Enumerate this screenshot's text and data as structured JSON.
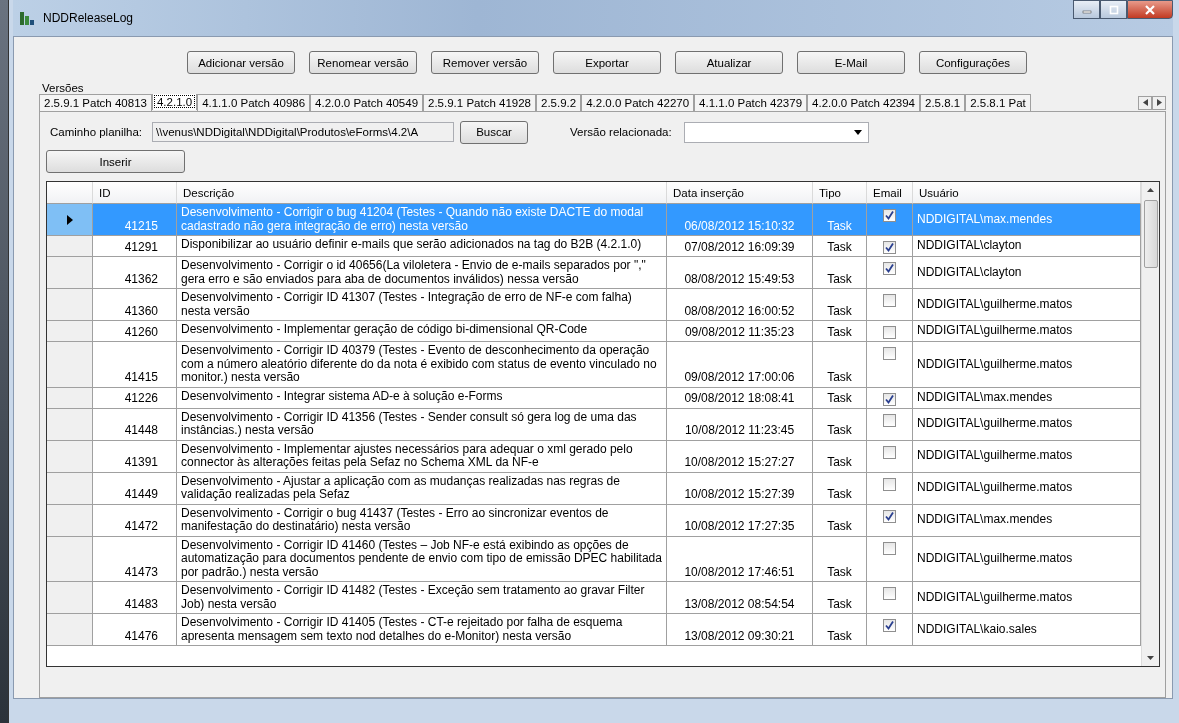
{
  "window": {
    "title": "NDDReleaseLog"
  },
  "toolbar": [
    "Adicionar versão",
    "Renomear versão",
    "Remover versão",
    "Exportar",
    "Atualizar",
    "E-Mail",
    "Configurações"
  ],
  "versions_label": "Versões",
  "tabs": [
    {
      "label": "2.5.9.1 Patch 40813",
      "selected": false
    },
    {
      "label": "4.2.1.0",
      "selected": true
    },
    {
      "label": "4.1.1.0 Patch 40986",
      "selected": false
    },
    {
      "label": "4.2.0.0 Patch 40549",
      "selected": false
    },
    {
      "label": "2.5.9.1 Patch 41928",
      "selected": false
    },
    {
      "label": "2.5.9.2",
      "selected": false
    },
    {
      "label": "4.2.0.0 Patch 42270",
      "selected": false
    },
    {
      "label": "4.1.1.0 Patch 42379",
      "selected": false
    },
    {
      "label": "4.2.0.0 Patch 42394",
      "selected": false
    },
    {
      "label": "2.5.8.1",
      "selected": false
    },
    {
      "label": "2.5.8.1 Pat",
      "selected": false
    }
  ],
  "path": {
    "label": "Caminho planilha:",
    "value": "\\\\venus\\NDDigital\\NDDigital\\Produtos\\eForms\\4.2\\A"
  },
  "browse_button": "Buscar",
  "related": {
    "label": "Versão relacionada:"
  },
  "insert_button": "Inserir",
  "table": {
    "columns": [
      "ID",
      "Descrição",
      "Data inserção",
      "Tipo",
      "Email",
      "Usuário"
    ],
    "rows": [
      {
        "id": "41215",
        "description": "Desenvolvimento - Corrigir o bug 41204 (Testes - Quando não existe DACTE do modal cadastrado não gera integração de erro) nesta versão",
        "date": "06/08/2012 15:10:32",
        "type": "Task",
        "email": true,
        "user": "NDDIGITAL\\max.mendes",
        "selected": true
      },
      {
        "id": "41291",
        "description": "Disponibilizar ao usuário definir e-mails que serão adicionados na tag do B2B (4.2.1.0)",
        "date": "07/08/2012 16:09:39",
        "type": "Task",
        "email": true,
        "user": "NDDIGITAL\\clayton",
        "selected": false
      },
      {
        "id": "41362",
        "description": "Desenvolvimento - Corrigir o id 40656(La viloletera - Envio de e-mails separados por \",\" gera erro e são enviados para aba de documentos inválidos) nessa versão",
        "date": "08/08/2012 15:49:53",
        "type": "Task",
        "email": true,
        "user": "NDDIGITAL\\clayton",
        "selected": false
      },
      {
        "id": "41360",
        "description": "Desenvolvimento - Corrigir ID 41307 (Testes - Integração de erro de NF-e com falha) nesta versão",
        "date": "08/08/2012 16:00:52",
        "type": "Task",
        "email": false,
        "user": "NDDIGITAL\\guilherme.matos",
        "selected": false
      },
      {
        "id": "41260",
        "description": "Desenvolvimento - Implementar geração de código bi-dimensional QR-Code",
        "date": "09/08/2012 11:35:23",
        "type": "Task",
        "email": false,
        "user": "NDDIGITAL\\guilherme.matos",
        "selected": false
      },
      {
        "id": "41415",
        "description": "Desenvolvimento - Corrigir ID 40379 (Testes - Evento de desconhecimento da operação com a número aleatório diferente do da nota é exibido com status de evento vinculado no monitor.) nesta versão",
        "date": "09/08/2012 17:00:06",
        "type": "Task",
        "email": false,
        "user": "NDDIGITAL\\guilherme.matos",
        "selected": false
      },
      {
        "id": "41226",
        "description": "Desenvolvimento - Integrar sistema AD-e à solução e-Forms",
        "date": "09/08/2012 18:08:41",
        "type": "Task",
        "email": true,
        "user": "NDDIGITAL\\max.mendes",
        "selected": false
      },
      {
        "id": "41448",
        "description": "Desenvolvimento - Corrigir ID 41356 (Testes - Sender consult só gera log de uma das instâncias.) nesta versão",
        "date": "10/08/2012 11:23:45",
        "type": "Task",
        "email": false,
        "user": "NDDIGITAL\\guilherme.matos",
        "selected": false
      },
      {
        "id": "41391",
        "description": "Desenvolvimento -  Implementar ajustes necessários para adequar o xml gerado pelo connector às alterações feitas pela Sefaz no Schema XML da NF-e",
        "date": "10/08/2012 15:27:27",
        "type": "Task",
        "email": false,
        "user": "NDDIGITAL\\guilherme.matos",
        "selected": false
      },
      {
        "id": "41449",
        "description": "Desenvolvimento - Ajustar a aplicação com as mudanças realizadas nas regras de validação realizadas pela Sefaz",
        "date": "10/08/2012 15:27:39",
        "type": "Task",
        "email": false,
        "user": "NDDIGITAL\\guilherme.matos",
        "selected": false
      },
      {
        "id": "41472",
        "description": "Desenvolvimento - Corrigir o bug 41437 (Testes - Erro ao sincronizar eventos de manifestação do destinatário) nesta versão",
        "date": "10/08/2012 17:27:35",
        "type": "Task",
        "email": true,
        "user": "NDDIGITAL\\max.mendes",
        "selected": false
      },
      {
        "id": "41473",
        "description": "Desenvolvimento - Corrigir ID 41460 (Testes – Job NF-e está exibindo as opções de automatização para documentos pendente de envio com tipo de emissão DPEC habilitada por padrão.) nesta versão",
        "date": "10/08/2012 17:46:51",
        "type": "Task",
        "email": false,
        "user": "NDDIGITAL\\guilherme.matos",
        "selected": false
      },
      {
        "id": "41483",
        "description": "Desenvolvimento - Corrigir ID 41482 (Testes - Exceção sem tratamento ao gravar Filter Job) nesta versão",
        "date": "13/08/2012 08:54:54",
        "type": "Task",
        "email": false,
        "user": "NDDIGITAL\\guilherme.matos",
        "selected": false
      },
      {
        "id": "41476",
        "description": "Desenvolvimento - Corrigir ID 41405 (Testes - CT-e rejeitado por falha de esquema apresenta mensagem sem texto nod detalhes do e-Monitor) nesta versão",
        "date": "13/08/2012 09:30:21",
        "type": "Task",
        "email": true,
        "user": "NDDIGITAL\\kaio.sales",
        "selected": false
      }
    ]
  }
}
